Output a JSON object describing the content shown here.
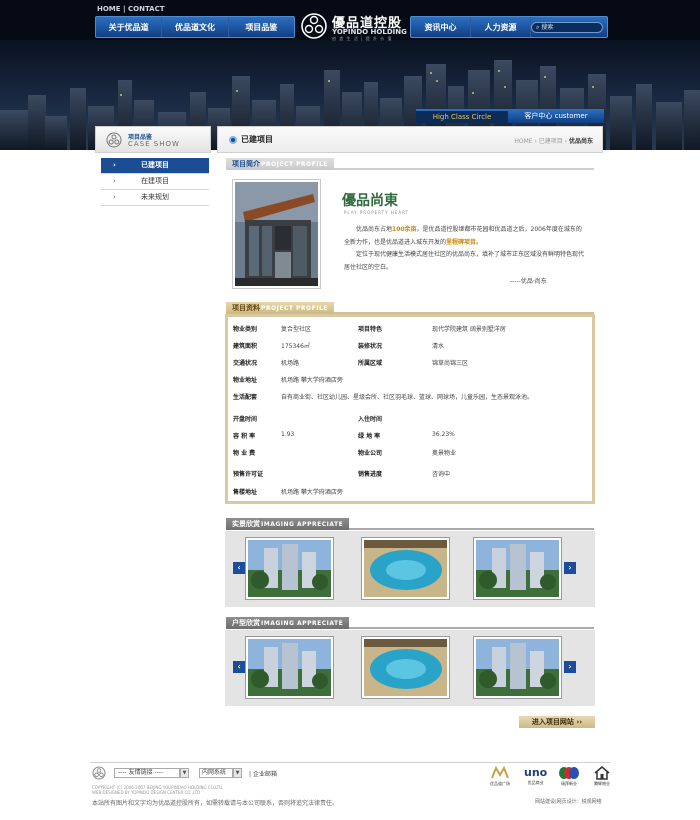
{
  "header": {
    "top_links": {
      "home": "HOME",
      "sep": "|",
      "contact": "CONTACT"
    },
    "nav_left": [
      "关于优品道",
      "优品道文化",
      "项目品鉴"
    ],
    "nav_right": [
      "资讯中心",
      "人力资源"
    ],
    "search_placeholder": "搜索",
    "logo": {
      "cn": "優品道控股",
      "en": "YOPINDO HOLDING",
      "sub": "创 造 生 活 | 提 升 价 值"
    },
    "tab_high_class": "High Class Circle",
    "tab_customer": "客户中心 customer"
  },
  "sidebar": {
    "title_cn": "项目品鉴",
    "title_en": "CASE SHOW",
    "items": [
      {
        "label": "已建项目",
        "active": true
      },
      {
        "label": "在建项目",
        "active": false
      },
      {
        "label": "未来规划",
        "active": false
      }
    ],
    "arrow": "›"
  },
  "main": {
    "title": "已建项目",
    "breadcrumb": {
      "home": "HOME",
      "sep1": " › ",
      "level1": "已建项目",
      "sep2": " › ",
      "current": "优品尚东"
    }
  },
  "intro": {
    "tab_cn": "项目简介",
    "tab_en": "PROJECT PROFILE",
    "brand_cn": "優品尚東",
    "brand_en": "PLAY PROPERTY HEART",
    "para1_a": "优品尚东占地",
    "para1_hl1": "100余亩",
    "para1_b": "，是优品道控股继都市花园和优品道之后，2006年度在城东的全新力作，也是优品道进入城东开发的",
    "para1_hl2": "里程碑项目",
    "para1_c": "。",
    "para2": "定位于现代健康生活模式居住社区的优品尚东，填补了城市正东区域没有鲜明特色现代居住社区的空白。",
    "sign": "-----优品·尚东"
  },
  "info": {
    "tab_cn": "项目资料",
    "tab_en": "PROJECT PROFILE",
    "rows": [
      {
        "k1": "物业类别",
        "v1": "复合型社区",
        "k2": "项目特色",
        "v2": "现代学院建筑 阔景别墅洋房"
      },
      {
        "k1": "建筑面积",
        "v1": "175346㎡",
        "k2": "装修状况",
        "v2": "清水"
      },
      {
        "k1": "交通状况",
        "v1": "机场路",
        "k2": "所属区域",
        "v2": "锦草尚锦三区"
      },
      {
        "k1": "物业地址",
        "v1": "机场路 攀大学府酒店旁",
        "k2": "",
        "v2": ""
      },
      {
        "k1": "生活配套",
        "v1": "自有商业街、社区幼儿园、星级会所、社区羽毛球、篮球、网球场，儿童乐园，生态景观泳池。",
        "k2": "",
        "v2": ""
      },
      {
        "k1": "开盘时间",
        "v1": "",
        "k2": "入住时间",
        "v2": ""
      },
      {
        "k1": "容 积 率",
        "v1": "1.93",
        "k2": "绿 地 率",
        "v2": "36.23%"
      },
      {
        "k1": "物 业 费",
        "v1": "",
        "k2": "物业公司",
        "v2": "奥景物业"
      },
      {
        "k1": "预售许可证",
        "v1": "",
        "k2": "销售进度",
        "v2": "咨询中"
      },
      {
        "k1": "售楼地址",
        "v1": "机场路 攀大学府酒店旁",
        "k2": "",
        "v2": ""
      }
    ]
  },
  "gallery1": {
    "tab_cn": "实景欣赏",
    "tab_en": "IMAGING APPRECIATE",
    "prev": "‹",
    "next": "›"
  },
  "gallery2": {
    "tab_cn": "户型欣赏",
    "tab_en": "IMAGING APPRECIATE",
    "prev": "‹",
    "next": "›"
  },
  "enter_button": "进入项目网站 ››",
  "footer": {
    "select1": "---- 友情链接 ----",
    "select2": "内网系统",
    "mail": "企业邮箱",
    "sep": "|",
    "copyright_1": "COPYRIGHT (C) 2006-2007 BEIJING YOUPINDAO HOLDING CO.LTD.",
    "copyright_2": "WEB DESIGNED BY YOPINDO DESIGN CENTER CO.,LTD",
    "note": "本站所有图片和文字均为优品道控股所有，如需转载请与本公司联系，否则将追究法律责任。",
    "partners": [
      "优品道广场",
      "优品商业",
      "瑞拜新业",
      "腾辉物业"
    ],
    "partner_marks": [
      "",
      "uno",
      "",
      ""
    ],
    "credit": "网站建设|网页设计：锐观网络"
  },
  "colors": {
    "brand_blue": "#1c4c94",
    "gold": "#d8c9a3",
    "highlight": "#c8870a"
  }
}
